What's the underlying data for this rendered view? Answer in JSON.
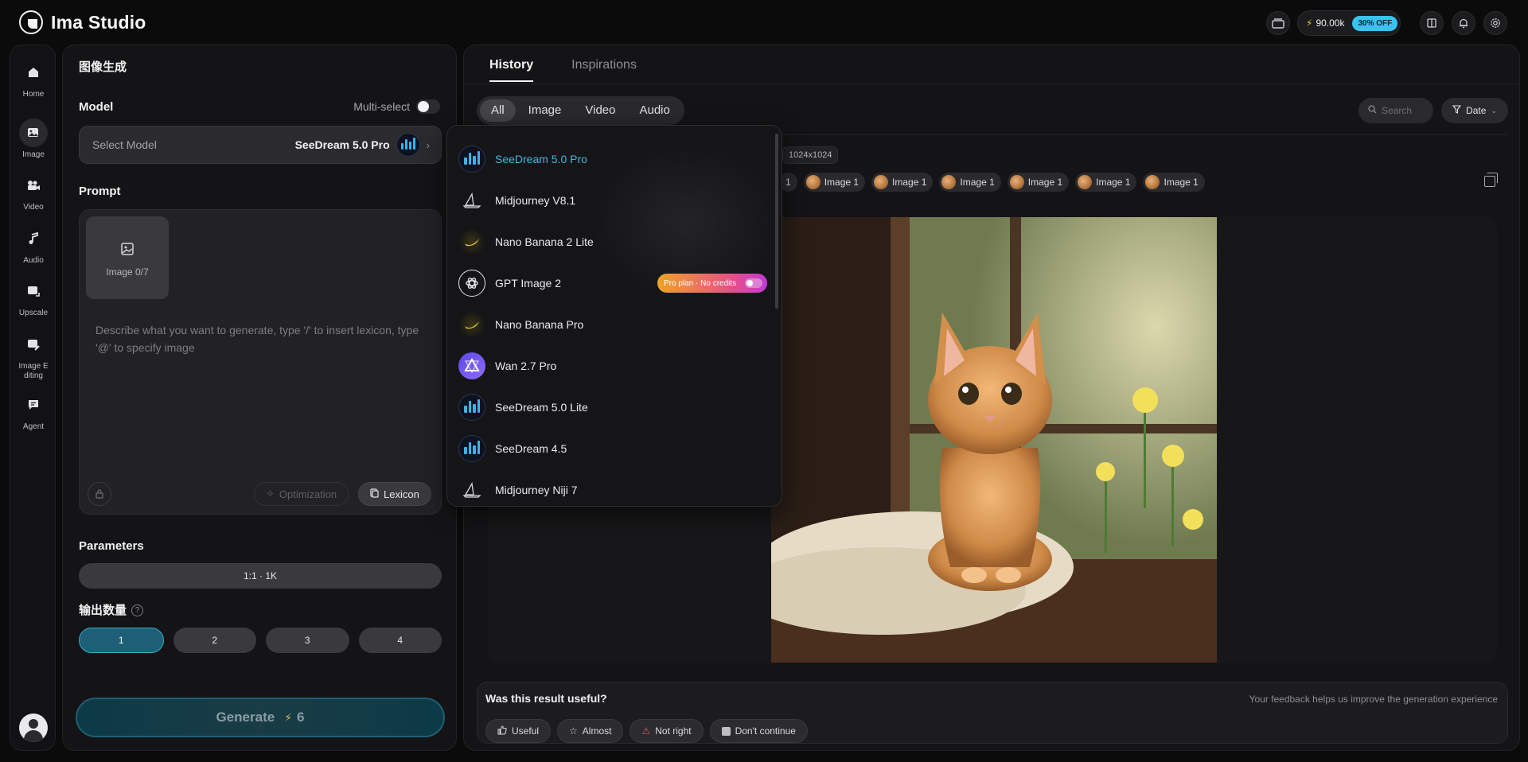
{
  "app": {
    "title": "Ima Studio"
  },
  "topbar": {
    "credits": "90.00k",
    "discount_badge": "30% OFF"
  },
  "sidenav": {
    "items": [
      {
        "label": "Home",
        "icon": "home-icon"
      },
      {
        "label": "Image",
        "icon": "image-icon"
      },
      {
        "label": "Video",
        "icon": "video-icon"
      },
      {
        "label": "Audio",
        "icon": "audio-icon"
      },
      {
        "label": "Upscale",
        "icon": "upscale-icon"
      },
      {
        "label": "Image E\nditing",
        "icon": "image-editing-icon"
      },
      {
        "label": "Agent",
        "icon": "agent-icon"
      }
    ]
  },
  "left": {
    "title": "图像生成",
    "model_heading": "Model",
    "multi_select_label": "Multi-select",
    "select_placeholder": "Select Model",
    "selected_model": "SeeDream 5.0 Pro",
    "prompt_heading": "Prompt",
    "image_slot_label": "Image 0/7",
    "prompt_placeholder": "Describe what you want to generate, type '/' to insert lexicon, type '@' to specify image",
    "optimization_label": "Optimization",
    "lexicon_label": "Lexicon",
    "parameters_heading": "Parameters",
    "parameters_value": "1:1 · 1K",
    "output_count_heading": "输出数量",
    "output_counts": [
      "1",
      "2",
      "3",
      "4"
    ],
    "output_count_selected": "1",
    "generate_label": "Generate",
    "generate_cost": "6"
  },
  "right": {
    "tabs": [
      "History",
      "Inspirations"
    ],
    "active_tab": "History",
    "filters": [
      "All",
      "Image",
      "Video",
      "Audio"
    ],
    "active_filter": "All",
    "search_placeholder": "Search",
    "date_label": "Date",
    "size_chip": "1024x1024",
    "partial_chip": "1",
    "image_chips": [
      "Image 1",
      "Image 1",
      "Image 1",
      "Image 1",
      "Image 1",
      "Image 1"
    ],
    "feedback": {
      "title": "Was this result useful?",
      "note": "Your feedback helps us improve the generation experience",
      "buttons": [
        "Useful",
        "Almost",
        "Not right",
        "Don't continue"
      ]
    }
  },
  "model_dropdown": {
    "items": [
      {
        "name": "SeeDream 5.0 Pro",
        "logo": "seedream",
        "active": true
      },
      {
        "name": "Midjourney V8.1",
        "logo": "midjourney"
      },
      {
        "name": "Nano Banana 2 Lite",
        "logo": "banana"
      },
      {
        "name": "GPT Image 2",
        "logo": "openai",
        "tag": "Pro plan · No credits"
      },
      {
        "name": "Nano Banana Pro",
        "logo": "banana"
      },
      {
        "name": "Wan 2.7 Pro",
        "logo": "wan"
      },
      {
        "name": "SeeDream 5.0 Lite",
        "logo": "seedream"
      },
      {
        "name": "SeeDream 4.5",
        "logo": "seedream"
      },
      {
        "name": "Midjourney Niji 7",
        "logo": "midjourney"
      }
    ]
  },
  "colors": {
    "accent": "#42b6de",
    "discount": "#38c3f0",
    "pro_gradient_start": "#f0a323",
    "pro_gradient_end": "#c23ad8"
  }
}
